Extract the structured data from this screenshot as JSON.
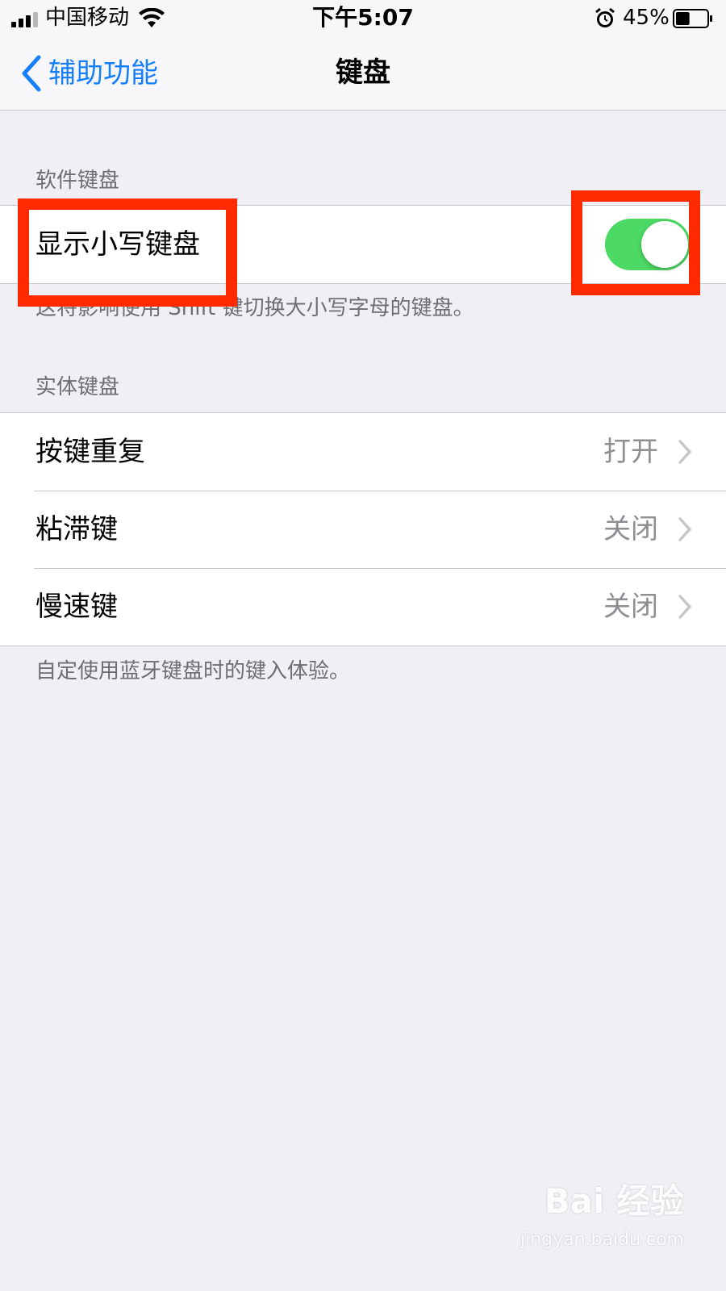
{
  "status_bar": {
    "carrier": "中国移动",
    "time": "下午5:07",
    "battery_percent": "45%",
    "battery_level": 0.45,
    "icons": [
      "signal-icon",
      "wifi-icon",
      "alarm-icon",
      "battery-icon"
    ]
  },
  "nav": {
    "back_label": "辅助功能",
    "title": "键盘",
    "back_icon": "chevron-left-icon"
  },
  "software_keyboard": {
    "header": "软件键盘",
    "rows": [
      {
        "label": "显示小写键盘",
        "toggle_on": true
      }
    ],
    "footer": "这将影响使用 Shift 键切换大小写字母的键盘。"
  },
  "hardware_keyboard": {
    "header": "实体键盘",
    "rows": [
      {
        "label": "按键重复",
        "value": "打开"
      },
      {
        "label": "粘滞键",
        "value": "关闭"
      },
      {
        "label": "慢速键",
        "value": "关闭"
      }
    ],
    "footer": "自定使用蓝牙键盘时的键入体验。"
  },
  "watermark": {
    "logo": "Bai 经验",
    "url": "jingyan.baidu.com"
  },
  "colors": {
    "accent": "#147efb",
    "toggle_on": "#4cd964",
    "background": "#efeff4",
    "annotation": "#ff2a00"
  }
}
